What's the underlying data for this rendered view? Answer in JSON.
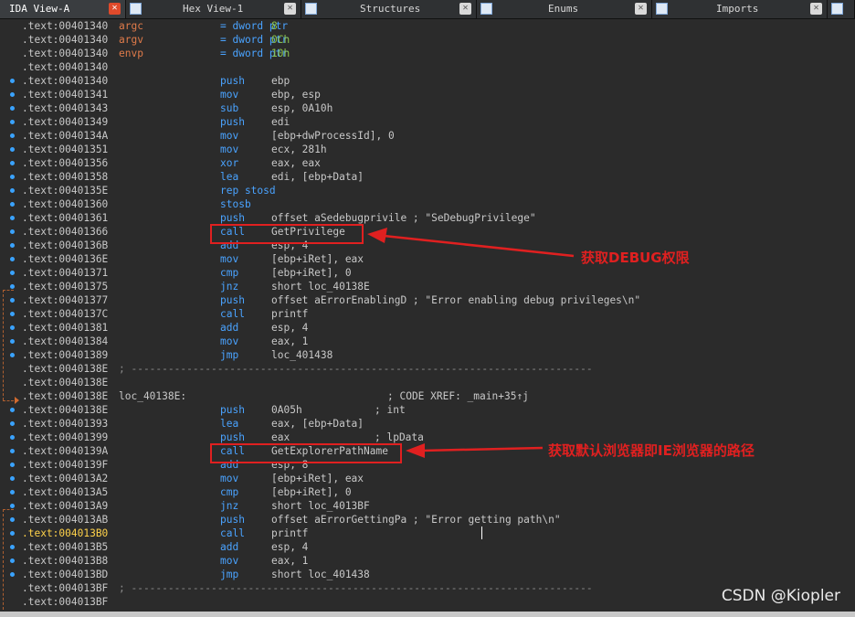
{
  "tabs": [
    {
      "label": "IDA View-A",
      "active": true
    },
    {
      "label": "Hex View-1",
      "active": false
    },
    {
      "label": "Structures",
      "active": false
    },
    {
      "label": "Enums",
      "active": false
    },
    {
      "label": "Imports",
      "active": false
    }
  ],
  "close_glyph": "✕",
  "lines": [
    {
      "addr": ".text:00401340",
      "label": "argc",
      "op": "= dword ptr",
      "operand": "8",
      "kind": "var"
    },
    {
      "addr": ".text:00401340",
      "label": "argv",
      "op": "= dword ptr",
      "operand": "0Ch",
      "kind": "var"
    },
    {
      "addr": ".text:00401340",
      "label": "envp",
      "op": "= dword ptr",
      "operand": "10h",
      "kind": "var"
    },
    {
      "addr": ".text:00401340"
    },
    {
      "addr": ".text:00401340",
      "op": "push",
      "operand": "ebp"
    },
    {
      "addr": ".text:00401341",
      "op": "mov",
      "operand": "ebp, esp"
    },
    {
      "addr": ".text:00401343",
      "op": "sub",
      "operand": "esp, 0A10h"
    },
    {
      "addr": ".text:00401349",
      "op": "push",
      "operand": "edi"
    },
    {
      "addr": ".text:0040134A",
      "op": "mov",
      "operand": "[ebp+dwProcessId], 0"
    },
    {
      "addr": ".text:00401351",
      "op": "mov",
      "operand": "ecx, 281h"
    },
    {
      "addr": ".text:00401356",
      "op": "xor",
      "operand": "eax, eax"
    },
    {
      "addr": ".text:00401358",
      "op": "lea",
      "operand": "edi, [ebp+Data]"
    },
    {
      "addr": ".text:0040135E",
      "op": "rep stosd",
      "operand": ""
    },
    {
      "addr": ".text:00401360",
      "op": "stosb",
      "operand": ""
    },
    {
      "addr": ".text:00401361",
      "op": "push",
      "operand": "offset aSedebugprivile ; \"SeDebugPrivilege\""
    },
    {
      "addr": ".text:00401366",
      "op": "call",
      "operand": "GetPrivilege"
    },
    {
      "addr": ".text:0040136B",
      "op": "add",
      "operand": "esp, 4"
    },
    {
      "addr": ".text:0040136E",
      "op": "mov",
      "operand": "[ebp+iRet], eax"
    },
    {
      "addr": ".text:00401371",
      "op": "cmp",
      "operand": "[ebp+iRet], 0"
    },
    {
      "addr": ".text:00401375",
      "op": "jnz",
      "operand": "short loc_40138E"
    },
    {
      "addr": ".text:00401377",
      "op": "push",
      "operand": "offset aErrorEnablingD ; \"Error enabling debug privileges\\n\""
    },
    {
      "addr": ".text:0040137C",
      "op": "call",
      "operand": "printf"
    },
    {
      "addr": ".text:00401381",
      "op": "add",
      "operand": "esp, 4"
    },
    {
      "addr": ".text:00401384",
      "op": "mov",
      "operand": "eax, 1"
    },
    {
      "addr": ".text:00401389",
      "op": "jmp",
      "operand": "loc_401438"
    },
    {
      "addr": ".text:0040138E",
      "sep": "; ---------------------------------------------------------------------------"
    },
    {
      "addr": ".text:0040138E"
    },
    {
      "addr": ".text:0040138E",
      "label": "loc_40138E:",
      "comment": "; CODE XREF: _main+35↑j"
    },
    {
      "addr": ".text:0040138E",
      "op": "push",
      "operand": "0A05h",
      "comment": "; int"
    },
    {
      "addr": ".text:00401393",
      "op": "lea",
      "operand": "eax, [ebp+Data]"
    },
    {
      "addr": ".text:00401399",
      "op": "push",
      "operand": "eax",
      "comment": "; lpData"
    },
    {
      "addr": ".text:0040139A",
      "op": "call",
      "operand": "GetExplorerPathName"
    },
    {
      "addr": ".text:0040139F",
      "op": "add",
      "operand": "esp, 8"
    },
    {
      "addr": ".text:004013A2",
      "op": "mov",
      "operand": "[ebp+iRet], eax"
    },
    {
      "addr": ".text:004013A5",
      "op": "cmp",
      "operand": "[ebp+iRet], 0"
    },
    {
      "addr": ".text:004013A9",
      "op": "jnz",
      "operand": "short loc_4013BF"
    },
    {
      "addr": ".text:004013AB",
      "op": "push",
      "operand": "offset aErrorGettingPa ; \"Error getting path\\n\""
    },
    {
      "addr": ".text:004013B0",
      "op": "call",
      "operand": "printf",
      "highlight": true
    },
    {
      "addr": ".text:004013B5",
      "op": "add",
      "operand": "esp, 4"
    },
    {
      "addr": ".text:004013B8",
      "op": "mov",
      "operand": "eax, 1"
    },
    {
      "addr": ".text:004013BD",
      "op": "jmp",
      "operand": "short loc_401438"
    },
    {
      "addr": ".text:004013BF",
      "sep": "; ---------------------------------------------------------------------------"
    },
    {
      "addr": ".text:004013BF"
    }
  ],
  "annotations": {
    "get_privilege": "获取DEBUG权限",
    "explorer_path": "获取默认浏览器即IE浏览器的路径"
  },
  "watermark": "CSDN @Kiopler",
  "colors": {
    "background": "#2b2b2b",
    "instruction": "#4aa3ff",
    "variable": "#8bc34a",
    "annotation": "#e02020",
    "highlight_address": "#ffd24a"
  }
}
